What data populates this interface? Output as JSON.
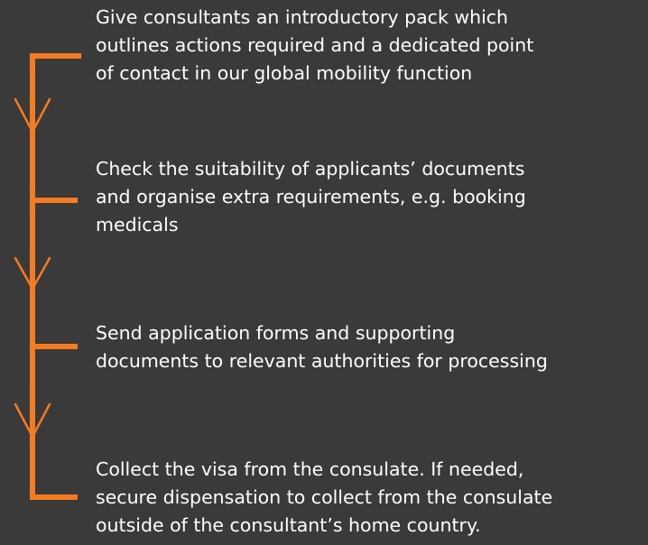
{
  "steps": [
    {
      "lines": [
        "Give consultants an introductory pack which",
        "outlines actions required and a dedicated point",
        "of contact in our global mobility function"
      ]
    },
    {
      "lines": [
        "Check the suitability of applicants’ documents",
        "and organise extra requirements, e.g. booking",
        "medicals"
      ]
    },
    {
      "lines": [
        "Send application forms and supporting",
        "documents to relevant authorities for processing"
      ]
    },
    {
      "lines": [
        "Collect the visa from the consulate. If needed,",
        "secure dispensation to collect from the consulate",
        "outside of the consultant’s home country."
      ]
    }
  ],
  "colors": {
    "background": "#3a3a3a",
    "accent": "#f47b20",
    "text": "#ffffff"
  }
}
